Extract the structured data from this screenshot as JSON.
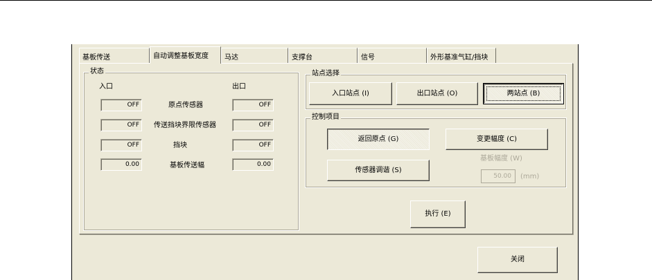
{
  "tabs": [
    "基板传送",
    "自动调整基板宽度",
    "马达",
    "支撑台",
    "信号",
    "外形基准气缸/挡块"
  ],
  "status": {
    "title": "状态",
    "entry_label": "入口",
    "exit_label": "出口",
    "rows": [
      {
        "label": "原点传感器",
        "entry": "OFF",
        "exit": "OFF"
      },
      {
        "label": "传送挡块界限传感器",
        "entry": "OFF",
        "exit": "OFF"
      },
      {
        "label": "挡块",
        "entry": "OFF",
        "exit": "OFF"
      },
      {
        "label": "基板传送幅",
        "entry": "0.00",
        "exit": "0.00"
      }
    ]
  },
  "station": {
    "title": "站点选择",
    "entry_btn": "入口站点 (I)",
    "exit_btn": "出口站点 (O)",
    "both_btn": "两站点 (B)"
  },
  "control": {
    "title": "控制项目",
    "return_origin_btn": "返回原点 (G)",
    "change_width_btn": "变更幅度 (C)",
    "sensor_adjust_btn": "传感器调谐 (S)",
    "width_label": "基板幅度 (W)",
    "width_value": "50.00",
    "width_unit": "(mm)"
  },
  "execute_btn": "执行 (E)",
  "close_btn": "关闭"
}
